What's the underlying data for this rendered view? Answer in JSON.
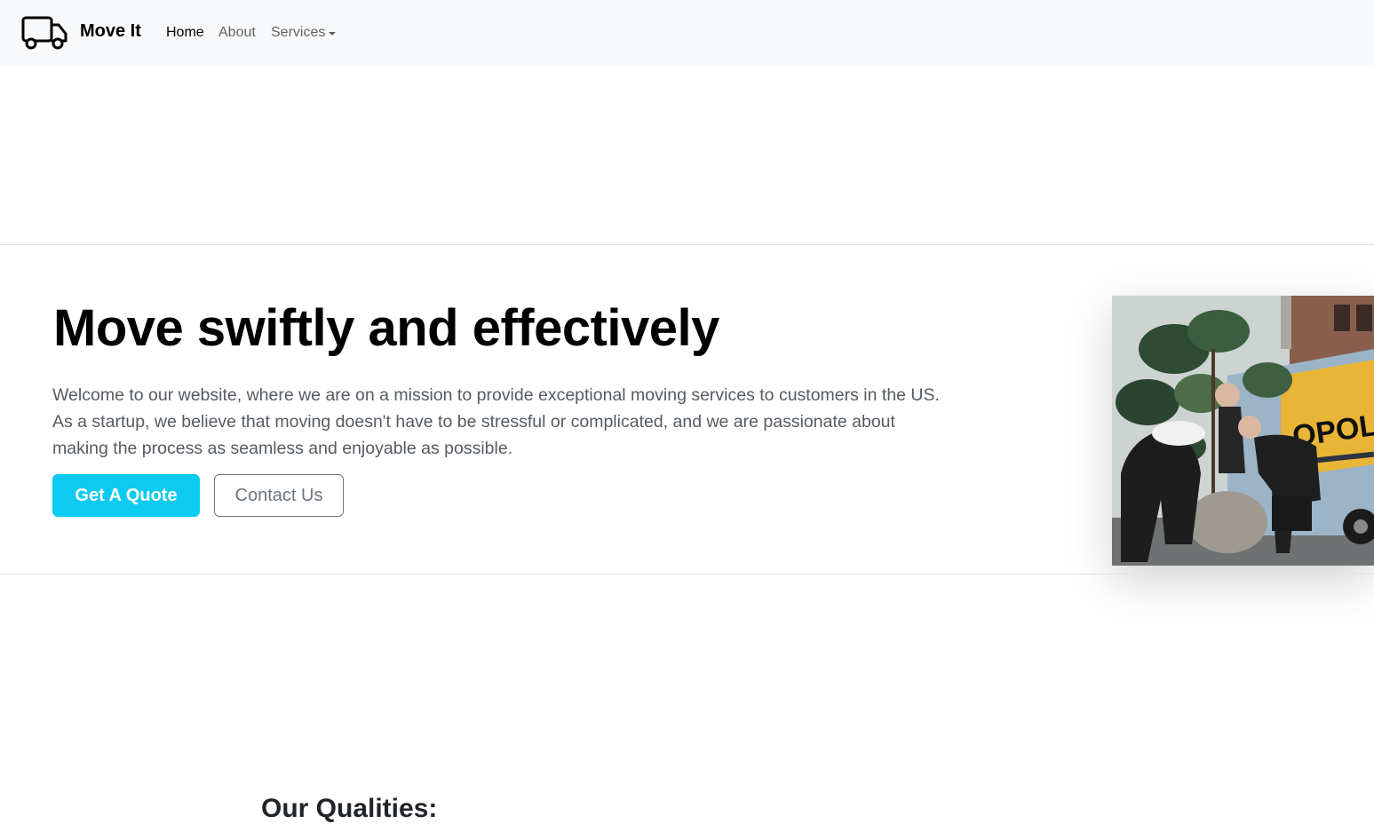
{
  "navbar": {
    "brand": "Move It",
    "logo_icon": "truck-icon",
    "links": [
      {
        "label": "Home",
        "active": true
      },
      {
        "label": "About",
        "active": false
      },
      {
        "label": "Services",
        "active": false,
        "dropdown": true
      }
    ]
  },
  "hero": {
    "title": "Move swiftly and effectively",
    "text": "Welcome to our website, where we are on a mission to provide exceptional moving services to customers in the US. As a startup, we believe that moving doesn't have to be stressful or complicated, and we are passionate about making the process as seamless and enjoyable as possible.",
    "primary_button": "Get A Quote",
    "secondary_button": "Contact Us",
    "accent_color": "#0dcaf0",
    "image_truck_text": "OPOLIS"
  },
  "qualities": {
    "title": "Our Qualities:"
  }
}
